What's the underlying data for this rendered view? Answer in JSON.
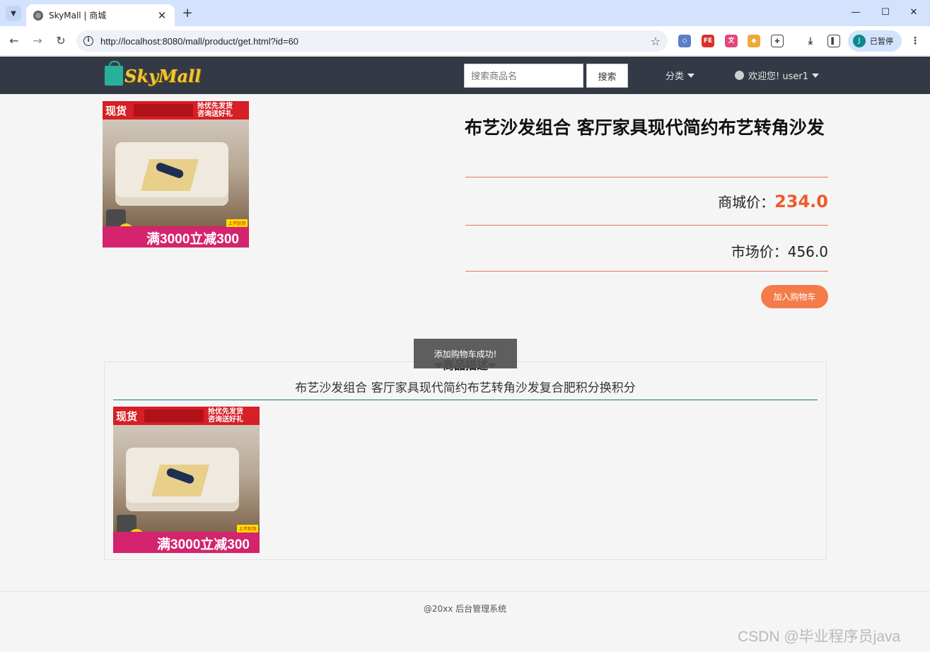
{
  "browser": {
    "tab_title": "SkyMall | 商城",
    "url": "http://localhost:8080/mall/product/get.html?id=60",
    "profile_initial": "J",
    "profile_label": "已暂停"
  },
  "site": {
    "logo_text": "SkyMall",
    "search_placeholder": "搜索商品名",
    "search_button": "搜索",
    "category_menu": "分类",
    "user_menu": "欢迎您! user1"
  },
  "product": {
    "title": "布艺沙发组合 客厅家具现代简约布艺转角沙发",
    "mall_price_label": "商城价：",
    "mall_price": "234.0",
    "market_price_label": "市场价：",
    "market_price": "456.0",
    "add_cart_label": "加入购物车",
    "image": {
      "banner_left": "现货",
      "banner_right_1": "抢优先发货",
      "banner_right_2": "咨询送好礼",
      "promo": "满3000立减300",
      "tag": "上不封顶"
    }
  },
  "description": {
    "heading": "商品描述",
    "text": "布艺沙发组合 客厅家具现代简约布艺转角沙发复合肥积分换积分"
  },
  "toast": "添加购物车成功!",
  "footer": "@20xx  后台管理系统",
  "watermark": "CSDN @毕业程序员java",
  "colors": {
    "nav_bg": "#343a45",
    "price_accent": "#ef5a2a",
    "button_accent": "#f47c4a",
    "divider": "#e7735a",
    "desc_line": "#137b7b"
  }
}
